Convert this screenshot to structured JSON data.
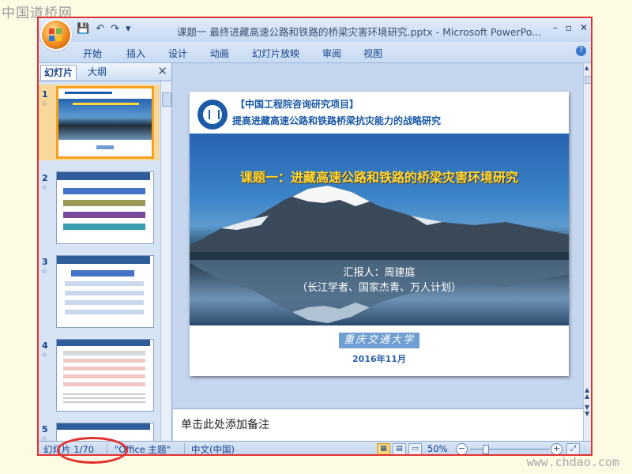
{
  "watermark": {
    "top": "中国道桥网",
    "bottom": "www.chdao.com"
  },
  "window": {
    "title": "课题一 最终进藏高速公路和铁路的桥梁灾害环境研究.pptx - Microsoft PowerPo..."
  },
  "quick_access": {
    "save": "💾",
    "undo": "↶",
    "redo": "↷",
    "customize": "▾"
  },
  "window_controls": {
    "minimize": "–",
    "restore": "▫",
    "close": "✕"
  },
  "ribbon_tabs": [
    "开始",
    "插入",
    "设计",
    "动画",
    "幻灯片放映",
    "审阅",
    "视图"
  ],
  "help_label": "?",
  "left_pane": {
    "tabs": [
      "幻灯片",
      "大纲"
    ],
    "close_label": "✕",
    "slides": [
      {
        "number": "1",
        "star": "☆"
      },
      {
        "number": "2",
        "star": "☆"
      },
      {
        "number": "3",
        "star": "☆"
      },
      {
        "number": "4",
        "star": "☆"
      },
      {
        "number": "5",
        "star": "☆"
      }
    ]
  },
  "slide": {
    "header_line1": "【中国工程院咨询研究项目】",
    "header_line2": "提高进藏高速公路和铁路桥梁抗灾能力的战略研究",
    "title": "课题一：进藏高速公路和铁路的桥梁灾害环境研究",
    "reporter": "汇报人：周建庭",
    "reporter_titles": "（长江学者、国家杰青、万人计划）",
    "university": "重庆交通大学",
    "date": "2016年11月"
  },
  "notes": {
    "placeholder": "单击此处添加备注"
  },
  "status_bar": {
    "slide_counter": "幻灯片 1/70",
    "theme": "\"Office 主题\"",
    "language": "中文(中国)",
    "zoom": "50%",
    "zoom_minus": "−",
    "zoom_plus": "+"
  },
  "colors": {
    "accent_red": "#e23131",
    "title_yellow": "#ffd83a",
    "header_blue": "#1a5aa6"
  }
}
